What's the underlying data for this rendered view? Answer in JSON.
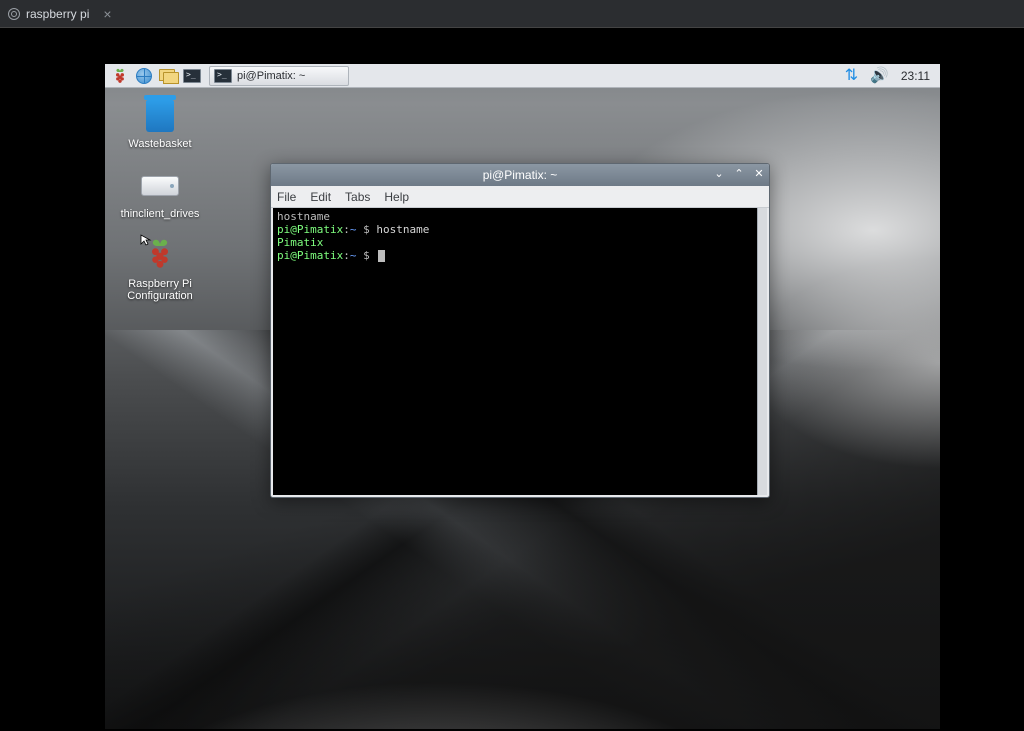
{
  "browser": {
    "tab_label": "raspberry pi"
  },
  "taskbar": {
    "open_app_label": "pi@Pimatix: ~",
    "clock": "23:11"
  },
  "desktop_icons": {
    "wastebasket": "Wastebasket",
    "thinclient": "thinclient_drives",
    "rpi_config": "Raspberry Pi Configuration"
  },
  "terminal": {
    "title": "pi@Pimatix: ~",
    "menu": {
      "file": "File",
      "edit": "Edit",
      "tabs": "Tabs",
      "help": "Help"
    },
    "lines": {
      "l1": "hostname",
      "prompt_user": "pi@Pimatix",
      "prompt_sep": ":",
      "prompt_path": "~",
      "prompt_dollar": "$",
      "cmd1": "hostname",
      "out1": "Pimatix"
    }
  }
}
